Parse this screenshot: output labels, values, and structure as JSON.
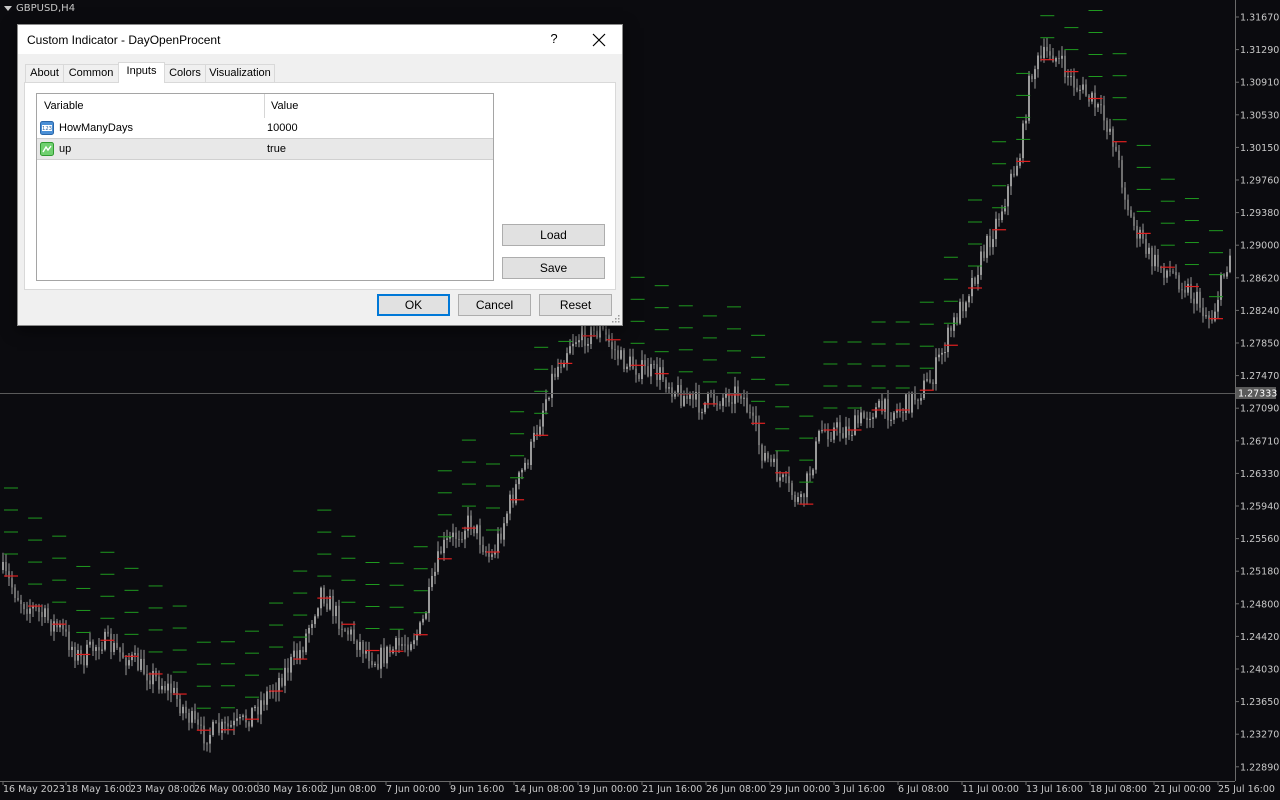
{
  "chart": {
    "symbol_label": "GBPUSD,H4",
    "price_axis_labels": [
      "1.31670",
      "1.31290",
      "1.30910",
      "1.30530",
      "1.30150",
      "1.29760",
      "1.29380",
      "1.29000",
      "1.28620",
      "1.28240",
      "1.27850",
      "1.27470",
      "1.27090",
      "1.26710",
      "1.26330",
      "1.25940",
      "1.25560",
      "1.25180",
      "1.24800",
      "1.24420",
      "1.24030",
      "1.23650",
      "1.23270",
      "1.22890"
    ],
    "current_price": "1.27333",
    "time_axis_labels": [
      "16 May 2023",
      "18 May 16:00",
      "23 May 08:00",
      "26 May 00:00",
      "30 May 16:00",
      "2 Jun 08:00",
      "7 Jun 00:00",
      "9 Jun 16:00",
      "14 Jun 08:00",
      "19 Jun 00:00",
      "21 Jun 16:00",
      "26 Jun 08:00",
      "29 Jun 00:00",
      "3 Jul 16:00",
      "6 Jul 08:00",
      "11 Jul 00:00",
      "13 Jul 16:00",
      "18 Jul 08:00",
      "21 Jul 00:00",
      "25 Jul 16:00"
    ],
    "colors": {
      "background": "#0b0b0f",
      "candle": "#9a9a9a",
      "level_green": "#1f9a1f",
      "day_open_red": "#e02020",
      "crosshair": "#5a5a5a"
    }
  },
  "dialog": {
    "title": "Custom Indicator - DayOpenProcent",
    "help_label": "?",
    "tabs": [
      "About",
      "Common",
      "Inputs",
      "Colors",
      "Visualization"
    ],
    "active_tab": "Inputs",
    "grid": {
      "headers": {
        "variable": "Variable",
        "value": "Value"
      },
      "rows": [
        {
          "icon": "integer-param-icon",
          "name": "HowManyDays",
          "value": "10000"
        },
        {
          "icon": "bool-param-icon",
          "name": "up",
          "value": "true"
        }
      ]
    },
    "buttons": {
      "load": "Load",
      "save": "Save",
      "ok": "OK",
      "cancel": "Cancel",
      "reset": "Reset"
    }
  }
}
